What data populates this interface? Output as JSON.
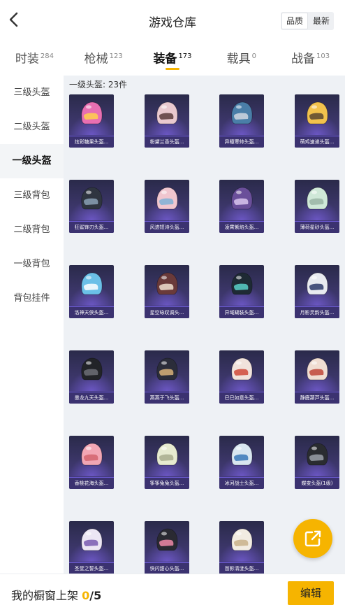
{
  "header": {
    "title": "游戏仓库",
    "sort_options": [
      "品质",
      "最新"
    ],
    "sort_selected": "品质"
  },
  "tabs": [
    {
      "label": "时装",
      "count": "284"
    },
    {
      "label": "枪械",
      "count": "123"
    },
    {
      "label": "装备",
      "count": "173",
      "active": true
    },
    {
      "label": "载具",
      "count": "0"
    },
    {
      "label": "战备",
      "count": "103"
    }
  ],
  "sidebar": {
    "items": [
      {
        "label": "三级头盔"
      },
      {
        "label": "二级头盔"
      },
      {
        "label": "一级头盔",
        "active": true
      },
      {
        "label": "三级背包"
      },
      {
        "label": "二级背包"
      },
      {
        "label": "一级背包"
      },
      {
        "label": "背包挂件"
      }
    ]
  },
  "section": {
    "title": "一级头盔: 23件"
  },
  "items": [
    {
      "name": "炫彩糖果头盔...",
      "color": "#e86fb2",
      "accent": "#ffd24a"
    },
    {
      "name": "粉黛兰香头盔...",
      "color": "#e9c9cf",
      "accent": "#5a3c3c"
    },
    {
      "name": "异瞳寒帅头盔...",
      "color": "#4a7ea8",
      "accent": "#d0d6e0"
    },
    {
      "name": "萌鸡速递头盔...",
      "color": "#f2c24d",
      "accent": "#5a4630"
    },
    {
      "name": "狂鲨锋刃头盔...",
      "color": "#2f3540",
      "accent": "#8aa0b5"
    },
    {
      "name": "风迹短诗头盔...",
      "color": "#f0c6cf",
      "accent": "#7fb0d6"
    },
    {
      "name": "凌霄紫焰头盔...",
      "color": "#6a4f9a",
      "accent": "#d9c6ef"
    },
    {
      "name": "薄荷星砂头盔...",
      "color": "#cfe8d8",
      "accent": "#9ab5a6"
    },
    {
      "name": "洛神天侠头盔...",
      "color": "#6bc0e8",
      "accent": "#ffffff"
    },
    {
      "name": "星空咏叹调头...",
      "color": "#6a3a3a",
      "accent": "#f0e0d0"
    },
    {
      "name": "异域蝴装头盔...",
      "color": "#1e2a34",
      "accent": "#59d0c8"
    },
    {
      "name": "月影灵韵头盔...",
      "color": "#e8eaf0",
      "accent": "#2d3a6a"
    },
    {
      "name": "墨龙九天头盔...",
      "color": "#222428",
      "accent": "#6c6f75"
    },
    {
      "name": "燕燕于飞头盔...",
      "color": "#2b2d3a",
      "accent": "#d8b37a"
    },
    {
      "name": "巳巳如意头盔...",
      "color": "#f1e3dc",
      "accent": "#d04a3a"
    },
    {
      "name": "静鹿葫芦头盔...",
      "color": "#f0ddd2",
      "accent": "#c0463a"
    },
    {
      "name": "香桃花海头盔...",
      "color": "#f2a6b4",
      "accent": "#d3646f"
    },
    {
      "name": "筝筝兔兔头盔...",
      "color": "#e6ead0",
      "accent": "#a8ad8e"
    },
    {
      "name": "冰河战士头盔...",
      "color": "#d8e6f0",
      "accent": "#3a78b8"
    },
    {
      "name": "蝶变头盔(1级)",
      "color": "#2a2c30",
      "accent": "#9aa0a8"
    },
    {
      "name": "圣堂之誓头盔...",
      "color": "#ece6f4",
      "accent": "#7a5ab0"
    },
    {
      "name": "快闪甜心头盔...",
      "color": "#2a2a32",
      "accent": "#f08aa8"
    },
    {
      "name": "苗影清涟头盔...",
      "color": "#f2ece2",
      "accent": "#c9b28a"
    }
  ],
  "bottom": {
    "showcase_label": "我的橱窗上架 ",
    "showcase_num": "0",
    "showcase_den": "/5",
    "edit_label": "编辑"
  },
  "icons": {
    "back": "chevron-left-icon",
    "share": "external-link-icon"
  },
  "colors": {
    "accent": "#f6b400",
    "card_bg": "#3a3566",
    "card_label_bg": "#3b3270"
  }
}
